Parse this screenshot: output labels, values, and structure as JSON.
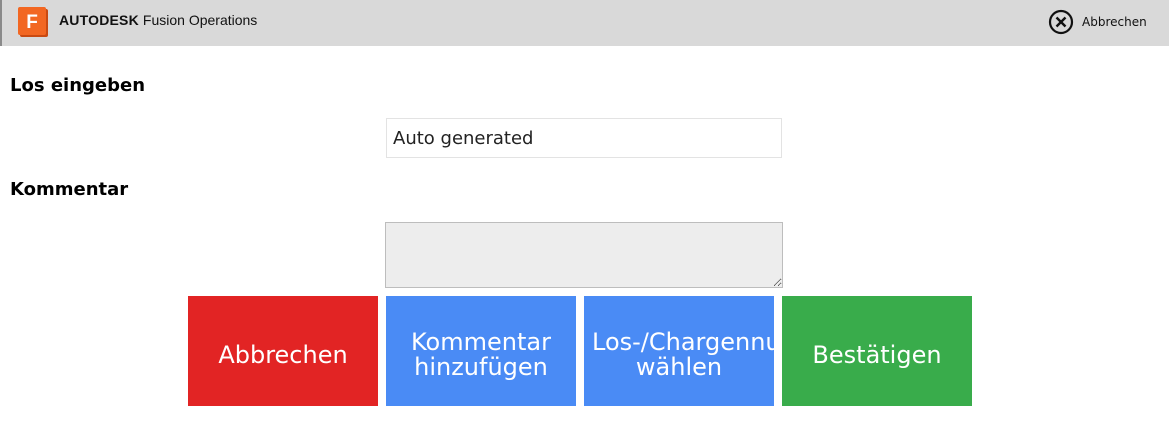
{
  "header": {
    "logo_letter": "F",
    "brand_company": "AUTODESK",
    "brand_product": "Fusion Operations",
    "cancel_label": "Abbrechen",
    "cancel_icon": "close-circle-icon"
  },
  "form": {
    "lot_label": "Los eingeben",
    "lot_value": "Auto generated",
    "comment_label": "Kommentar",
    "comment_value": ""
  },
  "actions": {
    "cancel": [
      "Abbrechen"
    ],
    "add_comment": [
      "Kommentar",
      "hinzufügen"
    ],
    "choose_lot": [
      "Los-/Chargennummer",
      "wählen"
    ],
    "confirm": [
      "Bestätigen"
    ]
  },
  "colors": {
    "topbar": "#d9d9d9",
    "cancel": "#e22424",
    "primary": "#4a8bf5",
    "confirm": "#39ac4b",
    "logo_orange": "#f26722"
  }
}
